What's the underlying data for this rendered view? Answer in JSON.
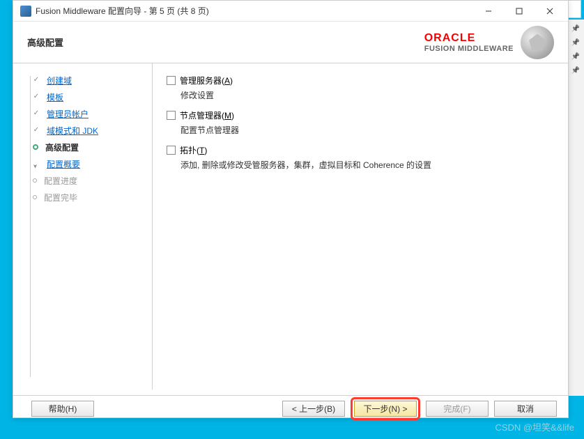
{
  "window": {
    "title": "Fusion Middleware 配置向导 - 第 5 页 (共 8 页)"
  },
  "header": {
    "title": "高级配置"
  },
  "brand": {
    "line1": "ORACLE",
    "line2": "FUSION MIDDLEWARE"
  },
  "sidebar": {
    "steps": [
      {
        "label": "创建域",
        "state": "done",
        "link": true
      },
      {
        "label": "模板",
        "state": "done",
        "link": true
      },
      {
        "label": "管理员帐户",
        "state": "done",
        "link": true
      },
      {
        "label": "域模式和 JDK",
        "state": "done",
        "link": true
      },
      {
        "label": "高级配置",
        "state": "current",
        "link": false
      },
      {
        "label": "配置概要",
        "state": "arrow",
        "link": true
      },
      {
        "label": "配置进度",
        "state": "pending",
        "link": false,
        "disabled": true
      },
      {
        "label": "配置完毕",
        "state": "pending",
        "link": false,
        "disabled": true
      }
    ]
  },
  "options": [
    {
      "label_pre": "管理服务器(",
      "hotkey": "A",
      "label_post": ")",
      "desc": "修改设置"
    },
    {
      "label_pre": "节点管理器(",
      "hotkey": "M",
      "label_post": ")",
      "desc": "配置节点管理器"
    },
    {
      "label_pre": "拓扑(",
      "hotkey": "T",
      "label_post": ")",
      "desc": "添加, 删除或修改受管服务器，集群，虚拟目标和 Coherence 的设置"
    }
  ],
  "footer": {
    "help": "帮助(H)",
    "back": "< 上一步(B)",
    "next": "下一步(N) >",
    "finish": "完成(F)",
    "cancel": "取消"
  },
  "watermark": "CSDN @坦笑&&life"
}
